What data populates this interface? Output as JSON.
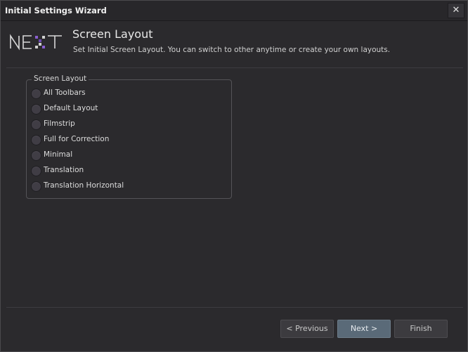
{
  "window": {
    "title": "Initial Settings Wizard",
    "close_label": "✕"
  },
  "header": {
    "logo_text": "NEXT",
    "title": "Screen Layout",
    "subtitle": "Set Initial Screen Layout. You can switch to other anytime or create your own layouts."
  },
  "group": {
    "legend": "Screen Layout",
    "options": [
      {
        "label": "All Toolbars",
        "selected": false
      },
      {
        "label": "Default Layout",
        "selected": false
      },
      {
        "label": "Filmstrip",
        "selected": false
      },
      {
        "label": "Full for Correction",
        "selected": false
      },
      {
        "label": "Minimal",
        "selected": false
      },
      {
        "label": "Translation",
        "selected": false
      },
      {
        "label": "Translation Horizontal",
        "selected": false
      }
    ]
  },
  "buttons": {
    "previous": "< Previous",
    "next": "Next >",
    "finish": "Finish"
  },
  "colors": {
    "background": "#2b2a2d",
    "accent": "#5a6a78",
    "logo_purple": "#8a5fd0"
  }
}
